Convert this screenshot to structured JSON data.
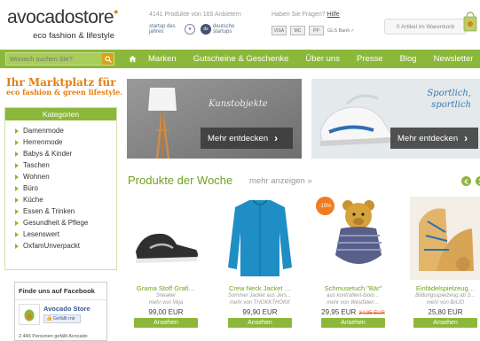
{
  "header": {
    "logo_name": "avocadostore",
    "logo_tagline": "eco fashion & lifestyle",
    "stats": "4141 Produkte von 165 Anbietern",
    "trust_badges": [
      "startup des jahres",
      "deutsche startups"
    ],
    "help_text": "Haben Sie Fragen?",
    "help_link": "Hilfe",
    "payment_cards": [
      "VISA",
      "MC",
      "PP"
    ],
    "payment_note": "GLS Bank",
    "cart_text": "0 Artikel im Warenkorb"
  },
  "nav": {
    "search_placeholder": "Wonach suchen Sie?",
    "items": [
      "Marken",
      "Gutscheine & Geschenke",
      "Über uns",
      "Presse",
      "Blog",
      "Newsletter"
    ]
  },
  "sidebar": {
    "market_line1": "Ihr Marktplatz für",
    "market_line2": "eco fashion & green lifestyle.",
    "categories_title": "Kategorien",
    "categories": [
      "Damenmode",
      "Herrenmode",
      "Babys & Kinder",
      "Taschen",
      "Wohnen",
      "Büro",
      "Küche",
      "Essen & Trinken",
      "Gesundheit & Pflege",
      "Lesenswert",
      "OxfamUnverpackt"
    ],
    "facebook_title": "Finde uns auf Facebook",
    "facebook_page": "Avocado Store",
    "facebook_like": "Gefällt mir",
    "facebook_count": "2.446 Personen gefällt Avocado"
  },
  "banners": [
    {
      "script": "Kunstobjekte",
      "cta": "Mehr entdecken"
    },
    {
      "script_l1": "Sportlich,",
      "script_l2": "sportlich",
      "cta": "Mehr entdecken"
    }
  ],
  "products_section": {
    "title": "Produkte der Woche",
    "more": "mehr anzeigen »",
    "items": [
      {
        "title": "Grama Stoff Grafi…",
        "sub1": "Sneaker",
        "sub2": "mehr von Veja",
        "price": "99,00 EUR",
        "old_price": "",
        "badge": "",
        "cta": "Ansehen"
      },
      {
        "title": "Crew Neck Jacket …",
        "sub1": "Sommer Jacket aus Jers…",
        "sub2": "mehr von THOKKTHOKK",
        "price": "99,90 EUR",
        "old_price": "",
        "badge": "",
        "cta": "Ansehen"
      },
      {
        "title": "Schmusetuch \"Bär\"",
        "sub1": "aus kontrolliert-biolo…",
        "sub2": "mehr von Westfalen…",
        "price": "29,95 EUR",
        "old_price": "34,95 EUR",
        "badge": "-15%",
        "cta": "Ansehen"
      },
      {
        "title": "Einfädelspielzeug…",
        "sub1": "Bildungsspielzeug ab 3…",
        "sub2": "mehr von BAJO",
        "price": "25,80 EUR",
        "old_price": "",
        "badge": "",
        "cta": "Ansehen"
      }
    ]
  },
  "colors": {
    "brand_green": "#8bb83a",
    "brand_orange": "#e07f14",
    "title_green": "#6ea21f"
  }
}
